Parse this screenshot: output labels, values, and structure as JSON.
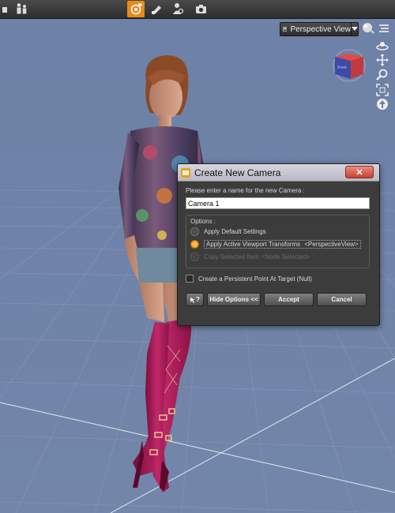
{
  "toolbar": {
    "icons": [
      "camera-arrow-icon",
      "scene-people-icon",
      "active-render-icon",
      "brush-icon",
      "figure-tool-icon",
      "camera-icon"
    ]
  },
  "viewport": {
    "view_label": "Perspective View",
    "tools": [
      "camera-select-icon",
      "sphere-icon",
      "menu-icon",
      "orbit-icon",
      "pan-icon",
      "zoom-icon",
      "frame-icon",
      "reset-icon"
    ],
    "cube_label": "Front"
  },
  "dialog": {
    "title": "Create New Camera",
    "close_label": "✕",
    "prompt": "Please enter a name for the new Camera :",
    "name_value": "Camera 1",
    "options_title": "Options :",
    "options": [
      {
        "label": "Apply Default Settings",
        "selected": false,
        "enabled": true
      },
      {
        "label": "Apply Active Viewport Transforms",
        "tag": "<PerspectiveView>",
        "selected": true,
        "enabled": true
      },
      {
        "label": "Copy Selected Item",
        "tag": "<Node Selected>",
        "selected": false,
        "enabled": false
      }
    ],
    "checkbox_label": "Create a Persistent Point At Target (Null)",
    "buttons": {
      "help": "?",
      "hide": "Hide Options <<",
      "accept": "Accept",
      "cancel": "Cancel"
    }
  },
  "colors": {
    "accent": "#e88a1a",
    "viewport_bg": "#6e81a6",
    "dialog_bg": "#3c3c3c",
    "boots": "#b01e5a"
  }
}
